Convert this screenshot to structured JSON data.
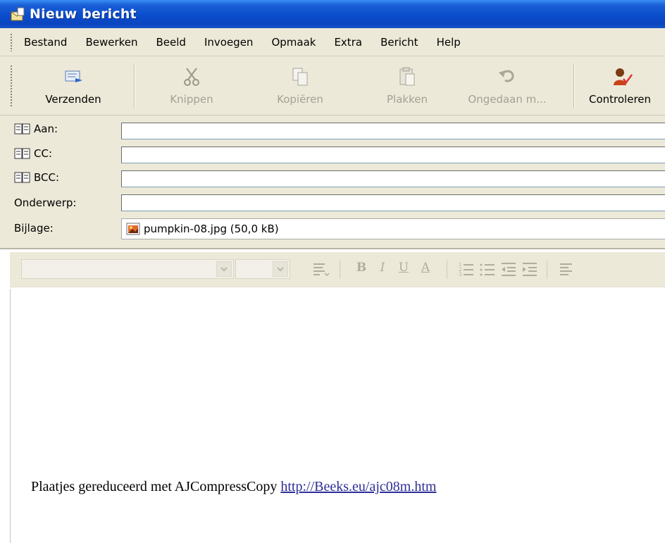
{
  "window": {
    "title": "Nieuw bericht"
  },
  "menu": [
    "Bestand",
    "Bewerken",
    "Beeld",
    "Invoegen",
    "Opmaak",
    "Extra",
    "Bericht",
    "Help"
  ],
  "toolbar": {
    "send": "Verzenden",
    "cut": "Knippen",
    "copy": "Kopiëren",
    "paste": "Plakken",
    "undo": "Ongedaan m...",
    "check": "Controleren"
  },
  "fields": {
    "to": {
      "label": "Aan:",
      "value": ""
    },
    "cc": {
      "label": "CC:",
      "value": ""
    },
    "bcc": {
      "label": "BCC:",
      "value": ""
    },
    "subject": {
      "label": "Onderwerp:",
      "value": ""
    },
    "attachment": {
      "label": "Bijlage:",
      "file": "pumpkin-08.jpg (50,0 kB)"
    }
  },
  "format": {
    "bold": "B",
    "italic": "I",
    "underline": "U",
    "fontcolor": "A"
  },
  "body": {
    "signature_text": "Plaatjes gereduceerd met AJCompressCopy ",
    "signature_link": "http://Beeks.eu/ajc08m.htm"
  },
  "colors": {
    "titlebar": "#0a4ccb",
    "chrome": "#ece9d8",
    "link": "#2e2e99"
  }
}
